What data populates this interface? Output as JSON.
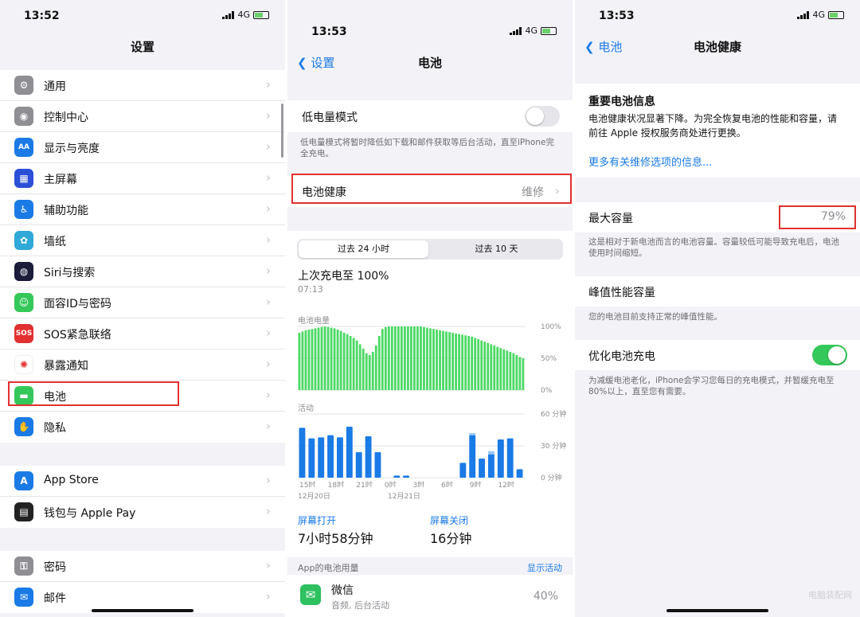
{
  "panel1": {
    "time": "13:52",
    "network": "4G",
    "title": "设置",
    "group1": [
      {
        "label": "通用",
        "icon": "gear-icon",
        "color": "#8e8e93",
        "glyph": "⚙"
      },
      {
        "label": "控制中心",
        "icon": "control-center-icon",
        "color": "#8e8e93",
        "glyph": "◉"
      },
      {
        "label": "显示与亮度",
        "icon": "display-icon",
        "color": "#1a7ae6",
        "glyph": "AA"
      },
      {
        "label": "主屏幕",
        "icon": "home-screen-icon",
        "color": "#2c4fd8",
        "glyph": "▦"
      },
      {
        "label": "辅助功能",
        "icon": "accessibility-icon",
        "color": "#1a7ae6",
        "glyph": "♿"
      },
      {
        "label": "墙纸",
        "icon": "wallpaper-icon",
        "color": "#30a8d8",
        "glyph": "✿"
      },
      {
        "label": "Siri与搜索",
        "icon": "siri-icon",
        "color": "#1b1b3a",
        "glyph": "◍"
      },
      {
        "label": "面容ID与密码",
        "icon": "face-id-icon",
        "color": "#34c759",
        "glyph": "☺"
      },
      {
        "label": "SOS紧急联络",
        "icon": "sos-icon",
        "color": "#e23030",
        "glyph": "SOS"
      },
      {
        "label": "暴露通知",
        "icon": "exposure-icon",
        "color": "#ffffff",
        "glyph": "✺"
      },
      {
        "label": "电池",
        "icon": "battery-icon",
        "color": "#34c759",
        "glyph": "▬"
      },
      {
        "label": "隐私",
        "icon": "hand-icon",
        "color": "#1a7ae6",
        "glyph": "✋"
      }
    ],
    "group2": [
      {
        "label": "App Store",
        "icon": "app-store-icon",
        "color": "#1a7ae6",
        "glyph": "A"
      },
      {
        "label": "钱包与 Apple Pay",
        "icon": "wallet-icon",
        "color": "#222222",
        "glyph": "▤"
      }
    ],
    "group3": [
      {
        "label": "密码",
        "icon": "key-icon",
        "color": "#8e8e93",
        "glyph": "⚿"
      },
      {
        "label": "邮件",
        "icon": "mail-icon",
        "color": "#1a7ae6",
        "glyph": "✉"
      }
    ]
  },
  "panel2": {
    "time": "13:53",
    "network": "4G",
    "back": "设置",
    "title": "电池",
    "low_power_label": "低电量模式",
    "low_power_note": "低电量模式将暂时降低如下载和邮件获取等后台活动，直至iPhone完全充电。",
    "battery_health_label": "电池健康",
    "battery_health_value": "维修",
    "tab_24h": "过去 24 小时",
    "tab_10d": "过去 10 天",
    "last_charge": "上次充电至 100%",
    "last_charge_time": "07:13",
    "level_title": "电池电量",
    "level_ticks": [
      "100%",
      "50%",
      "0%"
    ],
    "activity_title": "活动",
    "activity_ticks": [
      "60 分钟",
      "30 分钟",
      "0 分钟"
    ],
    "x_labels": [
      "15时",
      "18时",
      "21时",
      "0时",
      "3时",
      "6时",
      "9时",
      "12时"
    ],
    "date1": "12月20日",
    "date2": "12月21日",
    "screen_on_label": "屏幕打开",
    "screen_on_value": "7小时58分钟",
    "screen_off_label": "屏幕关闭",
    "screen_off_value": "16分钟",
    "app_usage_title": "App的电池用量",
    "show_activity": "显示活动",
    "app_name": "微信",
    "app_sub": "音频, 后台活动",
    "app_percent": "40%"
  },
  "panel3": {
    "time": "13:53",
    "network": "4G",
    "back": "电池",
    "title": "电池健康",
    "important_title": "重要电池信息",
    "important_body": "电池健康状况显著下降。为完全恢复电池的性能和容量，请前往 Apple 授权服务商处进行更换。",
    "repair_link": "更多有关维修选项的信息...",
    "max_capacity_label": "最大容量",
    "max_capacity_value": "79%",
    "max_capacity_note": "这是相对于新电池而言的电池容量。容量较低可能导致充电后，电池使用时间缩短。",
    "peak_label": "峰值性能容量",
    "peak_note": "您的电池目前支持正常的峰值性能。",
    "optimize_label": "优化电池充电",
    "optimize_note": "为减缓电池老化，iPhone会学习您每日的充电模式，并暂缓充电至80%以上，直至您有需要。",
    "watermark": "电脑装配网"
  },
  "chart_data": [
    {
      "type": "area",
      "title": "电池电量",
      "x_labels": [
        "15时",
        "18时",
        "21时",
        "0时",
        "3时",
        "6时",
        "9时",
        "12时"
      ],
      "ylim": [
        0,
        100
      ],
      "yticks": [
        "100%",
        "50%",
        "0%"
      ],
      "values": [
        90,
        92,
        94,
        95,
        96,
        97,
        98,
        99,
        100,
        99,
        98,
        97,
        95,
        93,
        90,
        88,
        85,
        82,
        78,
        72,
        65,
        58,
        55,
        60,
        70,
        85,
        96,
        99,
        100,
        100,
        100,
        100,
        100,
        100,
        100,
        100,
        100,
        100,
        100,
        99,
        98,
        97,
        96,
        95,
        94,
        93,
        92,
        91,
        90,
        89,
        88,
        87,
        86,
        85,
        84,
        82,
        80,
        78,
        76,
        74,
        72,
        70,
        68,
        66,
        64,
        62,
        60,
        58,
        55,
        52,
        50
      ]
    },
    {
      "type": "bar",
      "title": "活动",
      "x_labels": [
        "15时",
        "18时",
        "21时",
        "0时",
        "3时",
        "6时",
        "9时",
        "12时"
      ],
      "ylim": [
        0,
        60
      ],
      "yticks": [
        "60 分钟",
        "30 分钟",
        "0 分钟"
      ],
      "values": [
        47,
        37,
        38,
        40,
        38,
        48,
        24,
        39,
        24,
        0,
        2,
        2,
        0,
        0,
        0,
        0,
        0,
        14,
        40,
        18,
        22,
        36,
        37,
        8
      ],
      "secondary": [
        0,
        0,
        0,
        0,
        0,
        0,
        0,
        0,
        0,
        0,
        0,
        0,
        0,
        0,
        0,
        0,
        0,
        0,
        2,
        0,
        3,
        0,
        0,
        0
      ]
    }
  ]
}
